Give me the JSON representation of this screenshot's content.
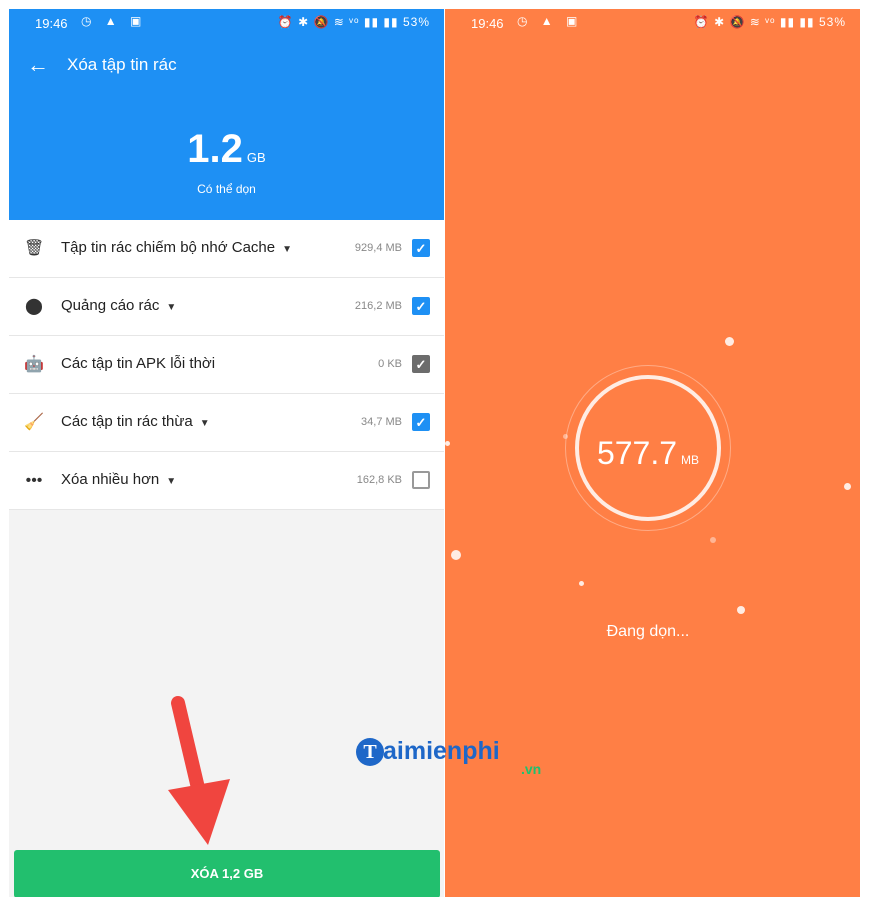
{
  "left": {
    "status_bar": {
      "time": "19:46",
      "icons_left": "◷ ▲ ▣",
      "icons_right": "⏰ ✱ 🔕 ≋ ᵛᵒ ▮▮ ▮▮",
      "battery": "53%"
    },
    "app_bar": {
      "title": "Xóa tập tin rác"
    },
    "summary": {
      "size_value": "1.2",
      "size_unit": "GB",
      "caption": "Có thể dọn"
    },
    "items": [
      {
        "icon": "trash-icon",
        "glyph": "🗑",
        "label": "Tập tin rác chiếm bộ nhớ Cache",
        "has_chevron": true,
        "size": "929,4 MB",
        "checked": true
      },
      {
        "icon": "ad-icon",
        "glyph": "⬤",
        "label": "Quảng cáo rác",
        "has_chevron": true,
        "size": "216,2 MB",
        "checked": true
      },
      {
        "icon": "android-icon",
        "glyph": "🤖",
        "label": "Các tập tin APK lỗi thời",
        "has_chevron": false,
        "size": "0 KB",
        "checked": true
      },
      {
        "icon": "broom-icon",
        "glyph": "🧹",
        "label": "Các tập tin rác thừa",
        "has_chevron": true,
        "size": "34,7 MB",
        "checked": true
      },
      {
        "icon": "more-icon",
        "glyph": "•••",
        "label": "Xóa nhiều hơn",
        "has_chevron": true,
        "size": "162,8 KB",
        "checked": false
      }
    ],
    "clean_button": "XÓA 1,2 GB"
  },
  "right": {
    "status_bar": {
      "time": "19:46",
      "icons_left": "◷ ▲ ▣",
      "icons_right": "⏰ ✱ 🔕 ≋ ᵛᵒ ▮▮ ▮▮",
      "battery": "53%"
    },
    "progress_value": "577.7",
    "progress_unit": "MB",
    "status_text": "Đang dọn..."
  },
  "watermark": {
    "logo_letter": "T",
    "brand": "aimienphi",
    "suffix": ".vn"
  },
  "colors": {
    "blue": "#1e90f4",
    "green": "#22bf6e",
    "orange": "#ff7f45",
    "arrow": "#f0453f"
  }
}
